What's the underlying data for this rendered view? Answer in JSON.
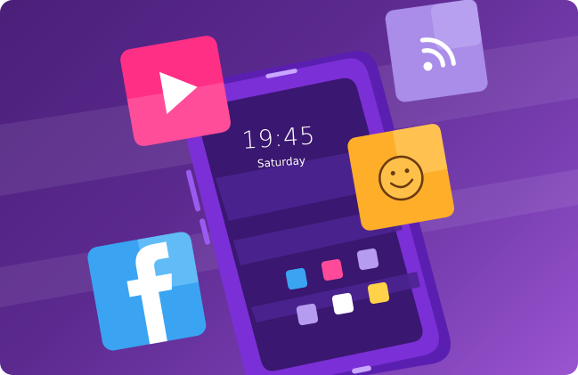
{
  "lock_screen": {
    "time": "19:45",
    "day": "Saturday"
  },
  "app_icons": [
    {
      "name": "video-play-icon",
      "color": "#ff2f86"
    },
    {
      "name": "wifi-icon",
      "color": "#a98de8"
    },
    {
      "name": "smiley-icon",
      "color": "#ffae2a"
    },
    {
      "name": "facebook-icon",
      "color": "#3aa4f2"
    }
  ],
  "home_grid_colors": [
    "#3aa4f2",
    "#ff4a9a",
    "#b69cf0",
    "#b69cf0",
    "#ffffff",
    "#ffd24a"
  ],
  "colors": {
    "background_start": "#4a1f7a",
    "background_end": "#9a55cf",
    "phone_body": "#7b2fd6",
    "phone_screen": "#3a1770"
  }
}
